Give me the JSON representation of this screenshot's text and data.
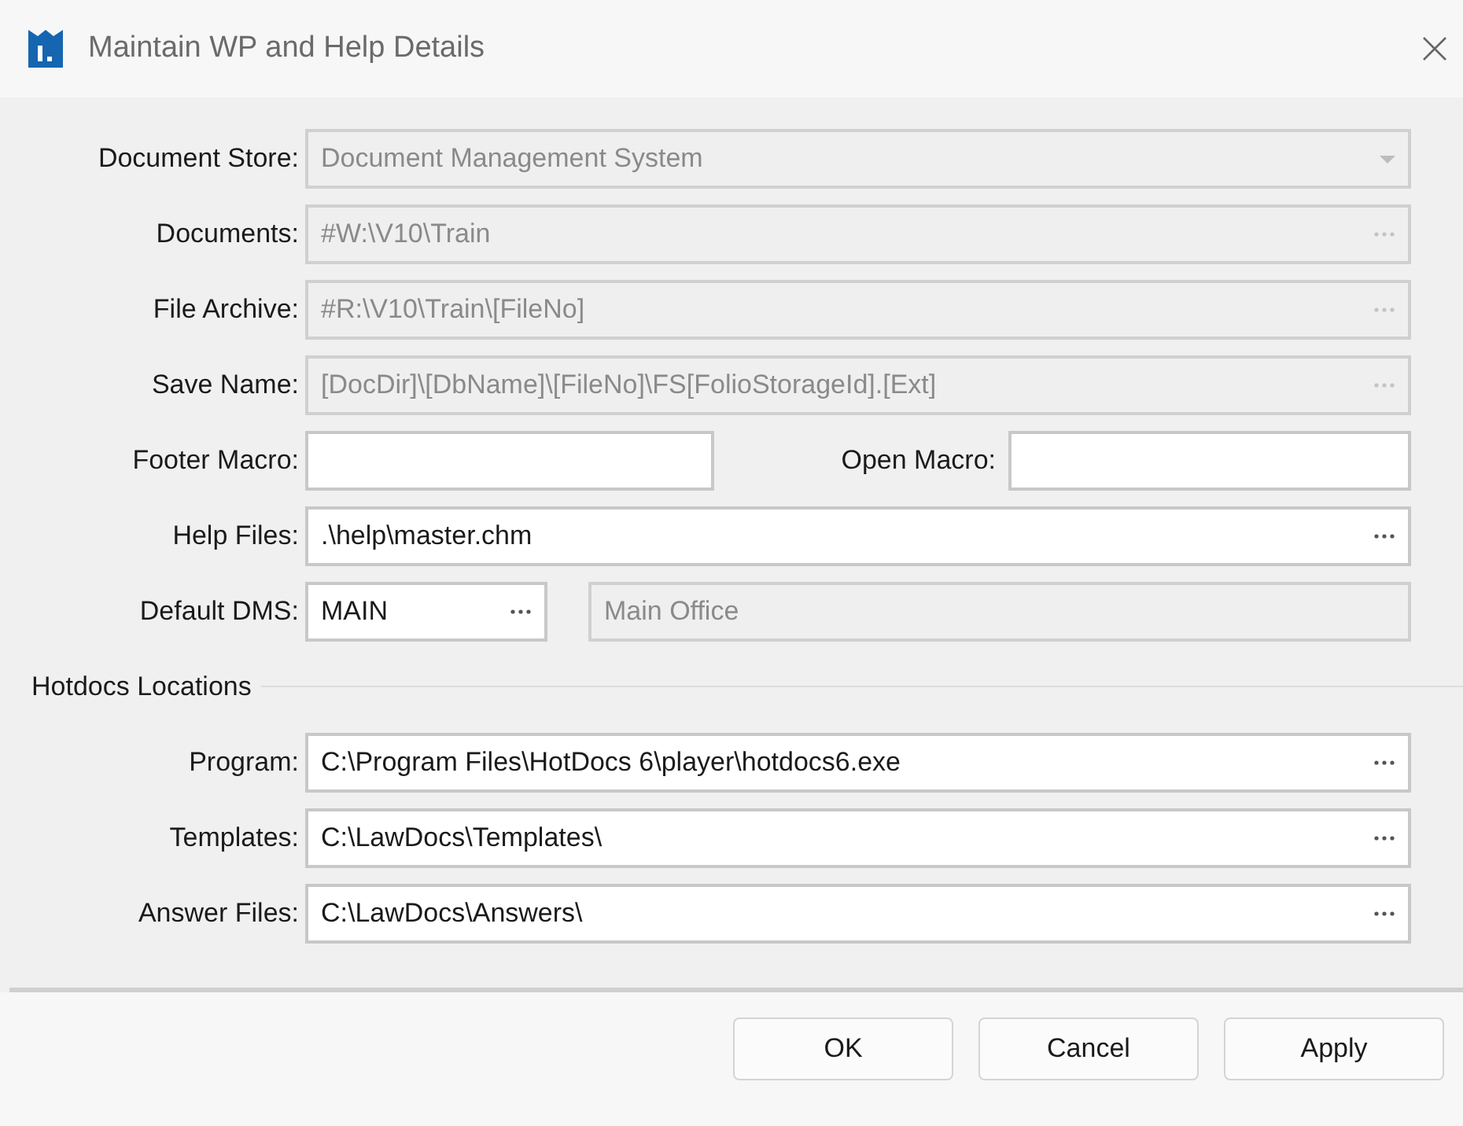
{
  "window": {
    "title": "Maintain WP and Help Details"
  },
  "fields": [
    {
      "label": "Document Store:",
      "value": "Document Management System",
      "kind": "dropdown",
      "disabled": true
    },
    {
      "label": "Documents:",
      "value": "#W:\\V10\\Train",
      "kind": "browse",
      "disabled": true
    },
    {
      "label": "File Archive:",
      "value": "#R:\\V10\\Train\\[FileNo]",
      "kind": "browse",
      "disabled": true
    },
    {
      "label": "Save Name:",
      "value": "[DocDir]\\[DbName]\\[FileNo]\\FS[FolioStorageId].[Ext]",
      "kind": "browse",
      "disabled": true
    }
  ],
  "macros": {
    "footer_label": "Footer Macro:",
    "open_label": "Open Macro:"
  },
  "help_files": {
    "label": "Help Files:",
    "value": ".\\help\\master.chm",
    "kind": "browse",
    "disabled": false
  },
  "default_dms": {
    "label": "Default DMS:",
    "value": "MAIN",
    "description": "Main Office"
  },
  "hotdocs": {
    "title": "Hotdocs Locations",
    "fields": [
      {
        "label": "Program:",
        "value": "C:\\Program Files\\HotDocs 6\\player\\hotdocs6.exe",
        "kind": "browse",
        "disabled": false
      },
      {
        "label": "Templates:",
        "value": "C:\\LawDocs\\Templates\\",
        "kind": "browse",
        "disabled": false
      },
      {
        "label": "Answer Files:",
        "value": "C:\\LawDocs\\Answers\\",
        "kind": "browse",
        "disabled": false
      }
    ]
  },
  "buttons": [
    "OK",
    "Cancel",
    "Apply"
  ]
}
